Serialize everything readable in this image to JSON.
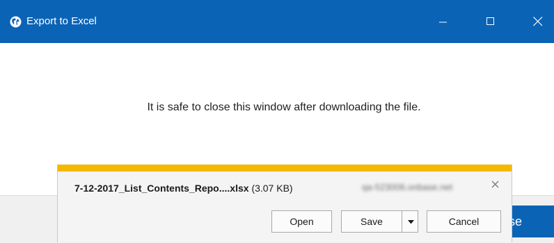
{
  "window": {
    "title": "Export to Excel",
    "icon": "globe-icon",
    "controls": [
      "minimize-icon",
      "maximize-icon",
      "close-icon"
    ],
    "accent_color": "#0b63b6"
  },
  "main": {
    "message": "It is safe to close this window after downloading the file.",
    "close_button_label": "Close",
    "close_button_visible_text": "ose"
  },
  "download_bar": {
    "file_name": "7-12-2017_List_Contents_Repo....xlsx",
    "file_size": "(3.07 KB)",
    "source_domain": "qa-523006.onbase.net",
    "accent_color": "#f5b800",
    "open_label": "Open",
    "save_label": "Save",
    "cancel_label": "Cancel",
    "dismiss_icon": "close-icon",
    "save_menu_icon": "caret-down-icon"
  }
}
